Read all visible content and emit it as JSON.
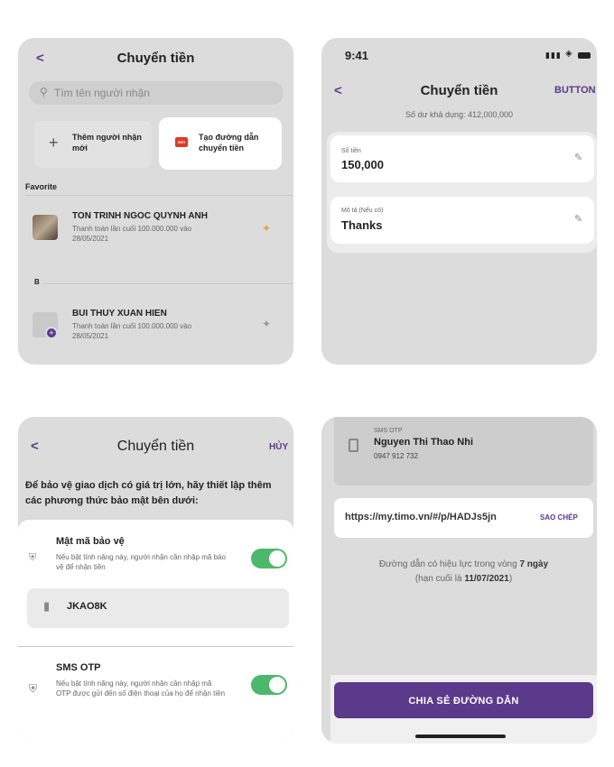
{
  "panel1": {
    "back": "<",
    "title": "Chuyển tiền",
    "search_placeholder": "Tìm tên người nhận",
    "add_plus": "+",
    "add_label": "Thêm người nhận mới",
    "link_badge": "MỚI",
    "link_label": "Tạo đường dẫn chuyển tiền",
    "favorite_header": "Favorite",
    "fav_contact": {
      "name": "TON TRINH NGOC QUYNH ANH",
      "detail": "Thanh toán lần cuối 100.000.000 vào 28/05/2021"
    },
    "section_b": "B",
    "b_contact": {
      "name": "BUI THUY XUAN HIEN",
      "detail": "Thanh toán lần cuối 100.000.000 vào 28/05/2021"
    }
  },
  "panel2": {
    "time": "9:41",
    "back": "<",
    "title": "Chuyển tiền",
    "action": "BUTTON",
    "balance": "Số dư khả dụng: 412,000,000",
    "amount_label": "Số tiền",
    "amount_value": "150,000",
    "desc_label": "Mô tả (Nếu có)",
    "desc_value": "Thanks"
  },
  "panel3": {
    "back": "<",
    "title": "Chuyển tiền",
    "action": "HỦY",
    "intro": "Để bảo vệ giao dịch có giá trị lớn, hãy thiết lập thêm các phương thức bảo mật bên dưới:",
    "pass_title": "Mật mã bảo vệ",
    "pass_desc": "Nếu bật tính năng này, người nhận cần nhập mã bảo vệ để nhận tiền",
    "pass_code": "JKAO8K",
    "otp_title": "SMS OTP",
    "otp_desc": "Nếu bật tính năng này, người nhận cần nhập mã OTP được gửi đến số điện thoại của họ để nhận tiền"
  },
  "panel4": {
    "otp_caption": "SMS OTP",
    "recipient_name": "Nguyen Thi Thao Nhi",
    "recipient_phone": "0947 912 732",
    "link_url": "https://my.timo.vn/#/p/HADJs5jn",
    "copy": "SAO CHÉP",
    "validity_1": "Đường dẫn có hiệu lực trong vòng",
    "validity_days": "7 ngày",
    "validity_2": "(hạn cuối là",
    "validity_date": "11/07/2021",
    "validity_close": ")",
    "share": "CHIA SẺ ĐƯỜNG DẪN"
  },
  "colors": {
    "accent": "#5b3a8c",
    "toggle_on": "#4cb86a",
    "pin_active": "#e8a33c",
    "badge": "#e0392b"
  }
}
